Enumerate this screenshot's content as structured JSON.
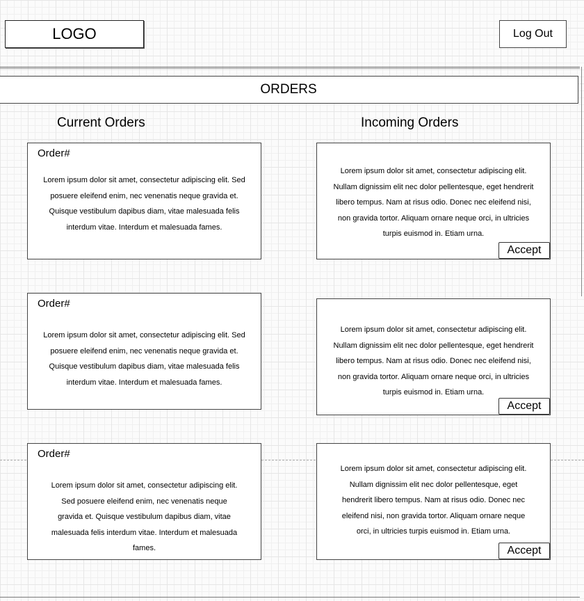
{
  "header": {
    "logo_text": "LOGO",
    "logout_label": "Log Out"
  },
  "banner": {
    "title": "ORDERS"
  },
  "current_orders": {
    "title": "Current Orders",
    "items": [
      {
        "label": "Order#",
        "text": "Lorem ipsum dolor sit amet, consectetur adipiscing elit. Sed posuere eleifend enim, nec venenatis neque gravida et. Quisque vestibulum dapibus diam, vitae malesuada felis interdum vitae. Interdum et malesuada fames."
      },
      {
        "label": "Order#",
        "text": "Lorem ipsum dolor sit amet, consectetur adipiscing elit. Sed posuere eleifend enim, nec venenatis neque gravida et. Quisque vestibulum dapibus diam, vitae malesuada felis interdum vitae. Interdum et malesuada fames."
      },
      {
        "label": "Order#",
        "text": "Lorem ipsum dolor sit amet, consectetur adipiscing elit. Sed posuere eleifend enim, nec venenatis neque gravida et. Quisque vestibulum dapibus diam, vitae malesuada felis interdum vitae. Interdum et malesuada fames."
      }
    ]
  },
  "incoming_orders": {
    "title": "Incoming Orders",
    "items": [
      {
        "text": "Lorem ipsum dolor sit amet, consectetur adipiscing elit. Nullam dignissim elit nec dolor pellentesque, eget hendrerit libero tempus. Nam at risus odio. Donec nec eleifend nisi, non gravida tortor. Aliquam ornare neque orci, in ultricies turpis euismod in. Etiam urna.",
        "accept_label": "Accept"
      },
      {
        "text": "Lorem ipsum dolor sit amet, consectetur adipiscing elit. Nullam dignissim elit nec dolor pellentesque, eget hendrerit libero tempus. Nam at risus odio. Donec nec eleifend nisi, non gravida tortor. Aliquam ornare neque orci, in ultricies turpis euismod in. Etiam urna.",
        "accept_label": "Accept"
      },
      {
        "text": "Lorem ipsum dolor sit amet, consectetur adipiscing elit. Nullam dignissim elit nec dolor pellentesque, eget hendrerit libero tempus. Nam at risus odio. Donec nec eleifend nisi, non gravida tortor. Aliquam ornare neque orci, in ultricies turpis euismod in. Etiam urna.",
        "accept_label": "Accept"
      }
    ]
  }
}
